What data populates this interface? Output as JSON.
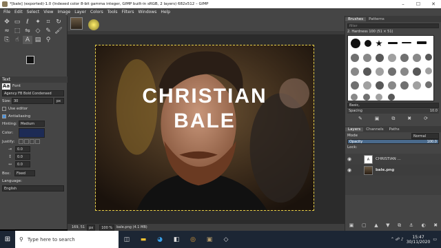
{
  "window": {
    "title": "*[bale] (exported)-1.0 (Indexed color 8-bit gamma integer, GIMP built-in sRGB, 2 layers) 682x512 – GIMP",
    "controls": [
      "–",
      "☐",
      "✕"
    ]
  },
  "menu": [
    "File",
    "Edit",
    "Select",
    "View",
    "Image",
    "Layer",
    "Colors",
    "Tools",
    "Filters",
    "Windows",
    "Help"
  ],
  "toolbox": {
    "tools": [
      "move",
      "rect-select",
      "lasso",
      "fuzzy-select",
      "crop",
      "rotate",
      "warp",
      "perspective",
      "flip",
      "cage",
      "eyedropper",
      "paintbrush",
      "clone",
      "smudge",
      "text",
      "gradient",
      "zoom",
      "measure"
    ],
    "fg_color": "#111111",
    "bg_color": "#ffffff"
  },
  "tool_options": {
    "section_title": "Text",
    "font_label": "Font",
    "font_value": "Agency FB Bold Condensed",
    "size_label": "Size:",
    "size_value": "30",
    "size_unit": "px",
    "use_editor": "Use editor",
    "antialiasing": "Antialiasing",
    "hinting_label": "Hinting:",
    "hinting_value": "Medium",
    "color_label": "Color:",
    "color_value": "#1d2b55",
    "justify_label": "Justify:",
    "indent": "0.0",
    "line_spacing": "0.0",
    "letter_spacing": "0.0",
    "box_label": "Box:",
    "box_value": "Fixed",
    "language_label": "Language:",
    "language_value": "English"
  },
  "canvas": {
    "text_line1": "CHRISTIAN",
    "text_line2": "BALE"
  },
  "statusbar": {
    "coords": "169, 51",
    "unit": "px",
    "zoom": "100 %",
    "file": "bale.png (4.1 MB)"
  },
  "brushes": {
    "tabs": [
      "Brushes",
      "Patterns"
    ],
    "filter_placeholder": "filter",
    "selected_brush": "2. Hardness 100 (51 × 51)",
    "preset": "Basic,",
    "spacing_label": "Spacing",
    "spacing_value": "10.0"
  },
  "layers": {
    "tabs": [
      "Layers",
      "Channels",
      "Paths"
    ],
    "mode_label": "Mode",
    "mode_value": "Normal",
    "opacity_label": "Opacity",
    "opacity_value": "100.0",
    "lock_label": "Lock:",
    "items": [
      {
        "name": "CHRISTIAN ...",
        "thumb": "A"
      },
      {
        "name": "bale.png",
        "thumb": ""
      }
    ]
  },
  "taskbar": {
    "search_placeholder": "Type here to search",
    "time": "15:47",
    "date": "30/11/2020"
  }
}
